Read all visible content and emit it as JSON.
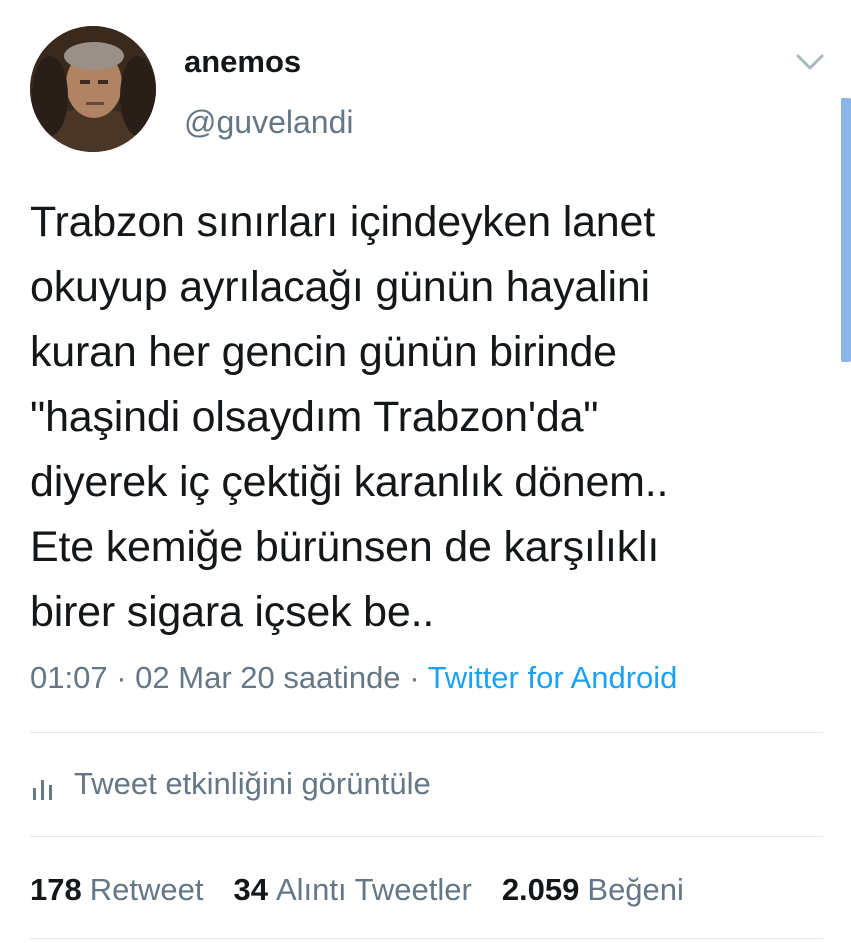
{
  "user": {
    "display_name": "anemos",
    "handle": "@guvelandi"
  },
  "tweet": {
    "lines": [
      "Trabzon sınırları içindeyken lanet",
      "okuyup ayrılacağı günün hayalini",
      "kuran her gencin günün birinde",
      "\"haşindi olsaydım Trabzon'da\"",
      "diyerek iç çektiği karanlık dönem..",
      "Ete kemiğe bürünsen de karşılıklı",
      "birer sigara içsek be.."
    ],
    "time": "01:07",
    "date": "02 Mar 20 saatinde",
    "separator": "·",
    "source": "Twitter for Android"
  },
  "activity": {
    "label": "Tweet etkinliğini görüntüle",
    "icon": "bar-chart-icon"
  },
  "stats": {
    "retweets": {
      "count": "178",
      "label": "Retweet"
    },
    "quotes": {
      "count": "34",
      "label": "Alıntı Tweetler"
    },
    "likes": {
      "count": "2.059",
      "label": "Beğeni"
    }
  },
  "colors": {
    "text": "#14171a",
    "secondary": "#657786",
    "link": "#1da1f2",
    "divider": "#e1e8ed"
  }
}
